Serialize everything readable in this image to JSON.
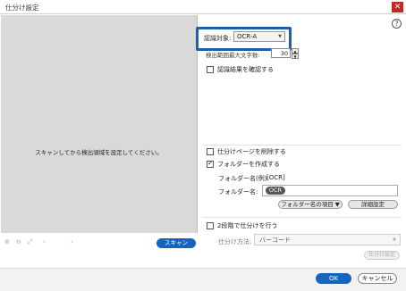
{
  "window": {
    "title": "仕分け設定",
    "close_glyph": "✕"
  },
  "help": {
    "glyph": "?"
  },
  "preview": {
    "message": "スキャンしてから検出領域を設定してください。",
    "toolbar_icons": [
      {
        "icon": "zoom-in-icon",
        "glyph": "⊕"
      },
      {
        "icon": "zoom-out-icon",
        "glyph": "⊖"
      },
      {
        "icon": "fit-icon",
        "glyph": "⤢"
      },
      {
        "icon": "prev-icon",
        "glyph": "‹"
      },
      {
        "icon": "next-icon",
        "glyph": "›"
      }
    ],
    "scan_label": "スキャン"
  },
  "recognition": {
    "label": "認識対象:",
    "selected": "OCR-A",
    "caret": "▼",
    "count_label": "検出範囲最大文字数:",
    "count_value": "30",
    "spin_up": "▲",
    "spin_down": "▼",
    "confirm_label": "認識結果を確認する"
  },
  "options": {
    "delete_pages_label": "仕分けページを削除する",
    "create_folder_label": "フォルダーを作成する",
    "folder_example_label": "フォルダー名(例):",
    "folder_example_value": "[OCR]",
    "folder_name_label": "フォルダー名:",
    "folder_chip": "OCR",
    "folder_items_label": "フォルダー名の項目 ▼",
    "detail_label": "詳細設定"
  },
  "two_stage": {
    "label": "2段階で仕分けを行う",
    "method_label": "仕分け方法:",
    "method_value": "バーコード",
    "method_caret": "▼",
    "settings_label": "仕分け設定"
  },
  "footer": {
    "ok_label": "OK",
    "cancel_label": "キャンセル"
  },
  "colors": {
    "accent": "#1565c0",
    "highlight": "#1f5ea8",
    "close": "#c42b1c"
  }
}
